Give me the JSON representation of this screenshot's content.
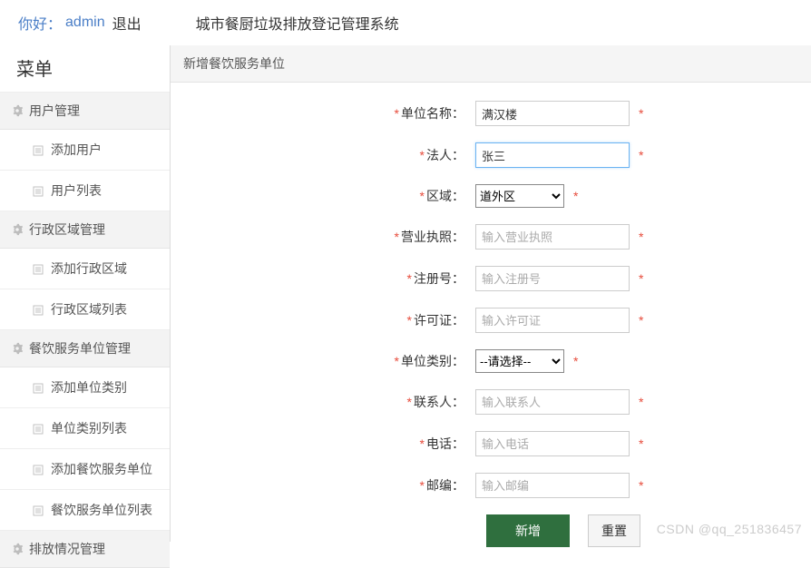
{
  "header": {
    "greeting": "你好：",
    "username": "admin",
    "logout": "退出",
    "system_title": "城市餐厨垃圾排放登记管理系统"
  },
  "sidebar": {
    "title": "菜单",
    "groups": [
      {
        "label": "用户管理",
        "subs": [
          "添加用户",
          "用户列表"
        ]
      },
      {
        "label": "行政区域管理",
        "subs": [
          "添加行政区域",
          "行政区域列表"
        ]
      },
      {
        "label": "餐饮服务单位管理",
        "subs": [
          "添加单位类别",
          "单位类别列表",
          "添加餐饮服务单位",
          "餐饮服务单位列表"
        ]
      },
      {
        "label": "排放情况管理",
        "subs": []
      }
    ]
  },
  "panel": {
    "title": "新增餐饮服务单位"
  },
  "form": {
    "unit_name_label": "单位名称：",
    "unit_name_value": "满汉楼",
    "legal_label": "法人：",
    "legal_value": "张三",
    "region_label": "区域：",
    "region_value": "道外区",
    "license_label": "营业执照：",
    "license_placeholder": "输入营业执照",
    "reg_label": "注册号：",
    "reg_placeholder": "输入注册号",
    "permit_label": "许可证：",
    "permit_placeholder": "输入许可证",
    "category_label": "单位类别：",
    "category_value": "--请选择--",
    "contact_label": "联系人：",
    "contact_placeholder": "输入联系人",
    "phone_label": "电话：",
    "phone_placeholder": "输入电话",
    "zip_label": "邮编：",
    "zip_placeholder": "输入邮编",
    "submit": "新增",
    "reset": "重置",
    "star": "*"
  },
  "watermark": "CSDN @qq_251836457"
}
